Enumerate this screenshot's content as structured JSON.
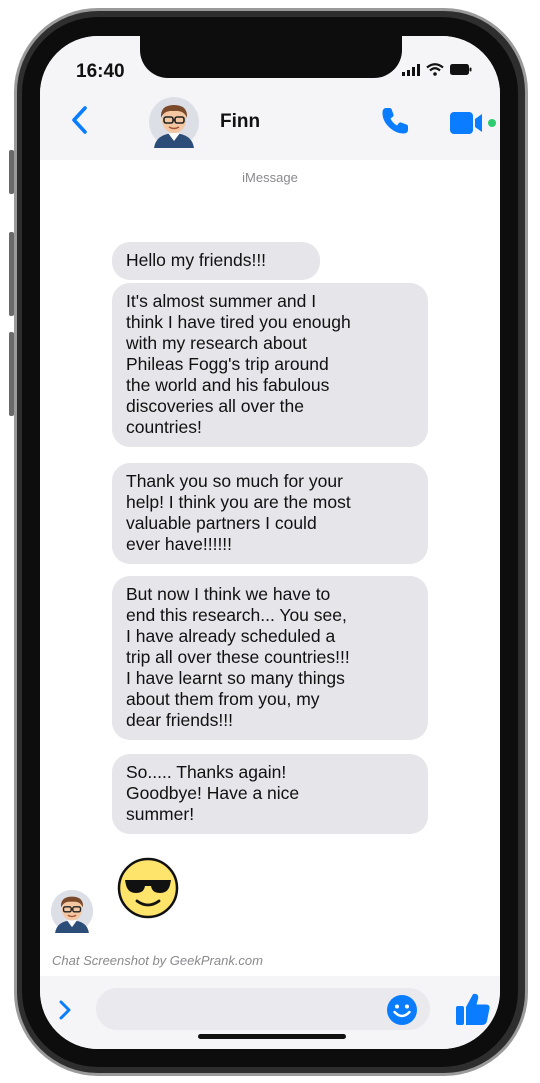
{
  "status_bar": {
    "time": "16:40"
  },
  "header": {
    "contact_name": "Finn"
  },
  "service_label": "iMessage",
  "messages": [
    "Hello my friends!!!",
    "It's almost summer and I\nthink I have tired you enough\nwith my research about\nPhileas Fogg's trip around\nthe world and his fabulous\ndiscoveries all over the\ncountries!",
    "Thank you so much for your\nhelp! I think you are the most\nvaluable partners I could\never have!!!!!!",
    "But now I think we have to\nend this research... You see,\nI have already scheduled a\ntrip all over these countries!!!\nI have learnt so many things\nabout them from you, my\ndear friends!!!",
    "So..... Thanks again!\nGoodbye! Have a nice\nsummer!"
  ],
  "watermark": "Chat Screenshot by GeekPrank.com",
  "colors": {
    "accent": "#0a7cff",
    "bubble_gray": "#e5e5ea",
    "header_bg": "#f5f5f7",
    "video_dot": "#2ecc71"
  },
  "icons": [
    "back-chevron-icon",
    "phone-icon",
    "video-camera-icon",
    "signal-icon",
    "wifi-icon",
    "battery-icon",
    "sunglasses-emoji-icon",
    "expand-chevron-icon",
    "smiley-icon",
    "thumbs-up-icon"
  ]
}
